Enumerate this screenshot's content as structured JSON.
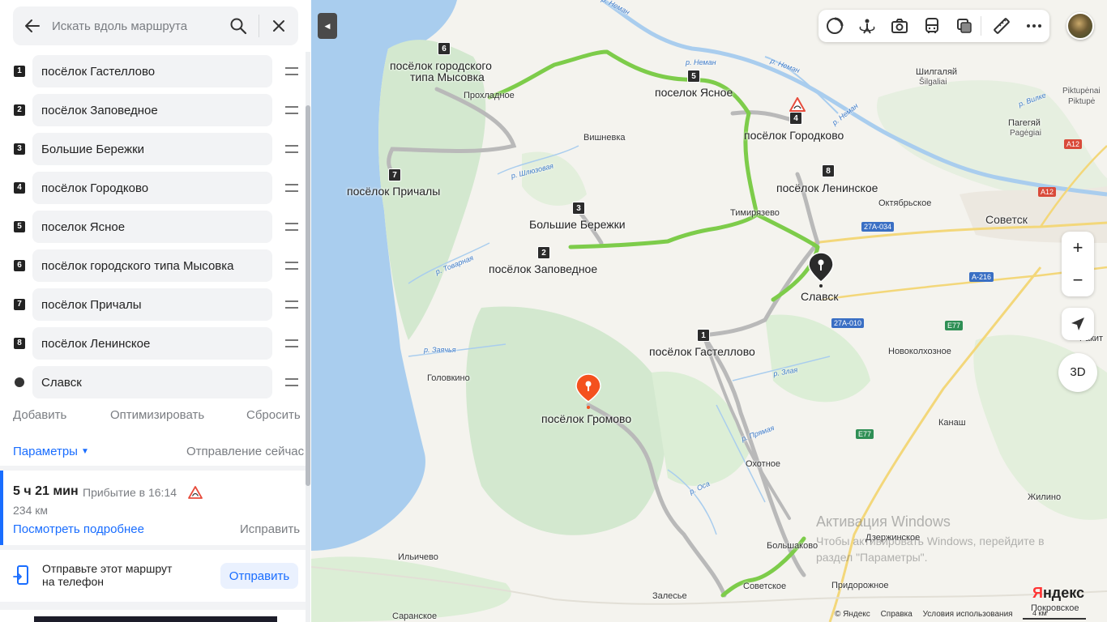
{
  "search": {
    "placeholder": "Искать вдоль маршрута"
  },
  "waypoints": [
    {
      "badge": "1",
      "label": "посёлок Гастеллово"
    },
    {
      "badge": "2",
      "label": "посёлок Заповедное"
    },
    {
      "badge": "3",
      "label": "Большие Бережки"
    },
    {
      "badge": "4",
      "label": "посёлок Городково"
    },
    {
      "badge": "5",
      "label": "поселок Ясное"
    },
    {
      "badge": "6",
      "label": "посёлок городского типа Мысовка"
    },
    {
      "badge": "7",
      "label": "посёлок Причалы"
    },
    {
      "badge": "8",
      "label": "посёлок Ленинское"
    },
    {
      "badge": "",
      "label": "Славск"
    }
  ],
  "actions": {
    "add": "Добавить",
    "optimize": "Оптимизировать",
    "reset": "Сбросить"
  },
  "params": {
    "label": "Параметры",
    "departure": "Отправление сейчас"
  },
  "route": {
    "duration": "5 ч 21 мин",
    "arrival": "Прибытие в 16:14",
    "distance": "234 км",
    "details": "Посмотреть подробнее",
    "fix": "Исправить"
  },
  "send": {
    "text_line1": "Отправьте этот маршрут",
    "text_line2": "на телефон",
    "button": "Отправить"
  },
  "map": {
    "colors": {
      "route": "#7dcc4a",
      "route_alt": "#b9b9b9",
      "water": "#a9cdee",
      "forest": "#d3e8cf",
      "accent": "#196dff",
      "pin": "#f4511e"
    },
    "badges": [
      "1",
      "2",
      "3",
      "4",
      "5",
      "6",
      "7",
      "8"
    ],
    "labels": {
      "p1": "посёлок Гастеллово",
      "p2": "посёлок Заповедное",
      "p3": "Большие Бережки",
      "p4": "посёлок Городково",
      "p5": "поселок Ясное",
      "p6a": "посёлок городского",
      "p6b": "типа Мысовка",
      "p7": "посёлок Причалы",
      "p8": "посёлок Ленинское",
      "slavsk": "Славск",
      "gromovo": "посёлок Громово",
      "sovetsk": "Советск",
      "prohladnoe": "Прохладное",
      "vishnevka": "Вишневка",
      "timiryazevo": "Тимирязево",
      "oktyabrskoe": "Октябрьское",
      "golovkino": "Головкино",
      "novokolkhoznoe": "Новоколхозное",
      "kanash": "Канаш",
      "ohotnoe": "Охотное",
      "zhilino": "Жилино",
      "dzerzhinskoe": "Дзержинское",
      "bolshakovo": "Большаково",
      "ilichevo": "Ильичево",
      "sovetskoe": "Советское",
      "pridorozhnoe": "Придорожное",
      "zalese": "Залесье",
      "saranskoe": "Саранское",
      "pokrovskoe": "Покровское",
      "shilgalyay1": "Шилгаляй",
      "shilgalyay2": "Šilgaliai",
      "pagegiai1": "Пагегяй",
      "pagegiai2": "Pagėgiai",
      "piktupe1": "Piktupėnai",
      "piktupe2": "Piktupė",
      "rakit": "Ракит"
    },
    "rivers": {
      "neman1": "р. Неман",
      "neman2": "р. Неман",
      "neman3": "р. Неман",
      "neman4": "р. Неман",
      "shlyuz": "р. Шлюзовая",
      "tovar": "р. Товарная",
      "zayach": "р. Заячья",
      "zlaya": "р. Злая",
      "pryam": "р. Прямая",
      "osa": "р. Оса",
      "vilke": "р. Вилке"
    },
    "shields": {
      "a12a": "A12",
      "a12b": "A12",
      "r27a034": "27А-034",
      "a216": "А-216",
      "r27a010": "27А-010",
      "e77a": "E77",
      "e77b": "E77"
    },
    "zoom_in": "+",
    "zoom_out": "−",
    "btn_3d": "3D",
    "watermark_title": "Активация Windows",
    "watermark_line1": "Чтобы активировать Windows, перейдите в",
    "watermark_line2": "раздел \"Параметры\".",
    "logo_first": "Я",
    "logo_rest": "ндекс",
    "copyright": "© Яндекс",
    "help": "Справка",
    "terms": "Условия использования",
    "scale": "4 км"
  }
}
